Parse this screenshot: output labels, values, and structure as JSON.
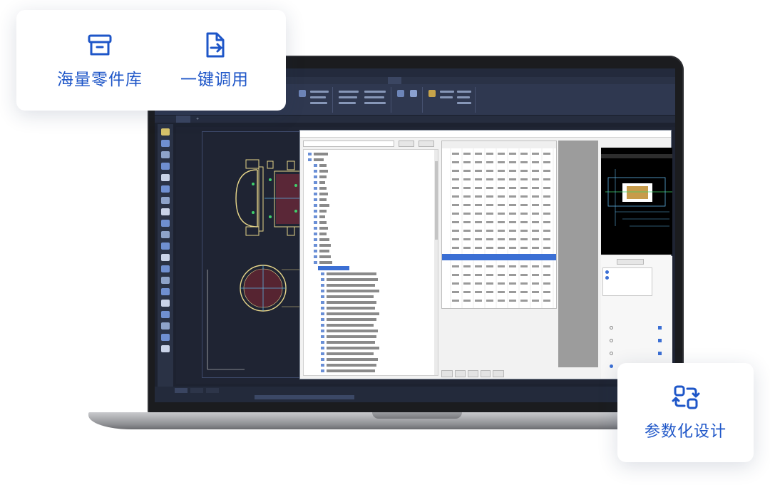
{
  "features": {
    "parts_library": {
      "label": "海量零件库",
      "icon": "archive-box-icon"
    },
    "one_click": {
      "label": "一键调用",
      "icon": "file-export-icon"
    },
    "parametric": {
      "label": "参数化设计",
      "icon": "refresh-cycle-icon"
    }
  },
  "colors": {
    "accent": "#1e56c8",
    "cad_background": "#1f2433",
    "table_highlight": "#3b6fd4"
  },
  "cad": {
    "ribbon_active_tab_index": 8
  }
}
